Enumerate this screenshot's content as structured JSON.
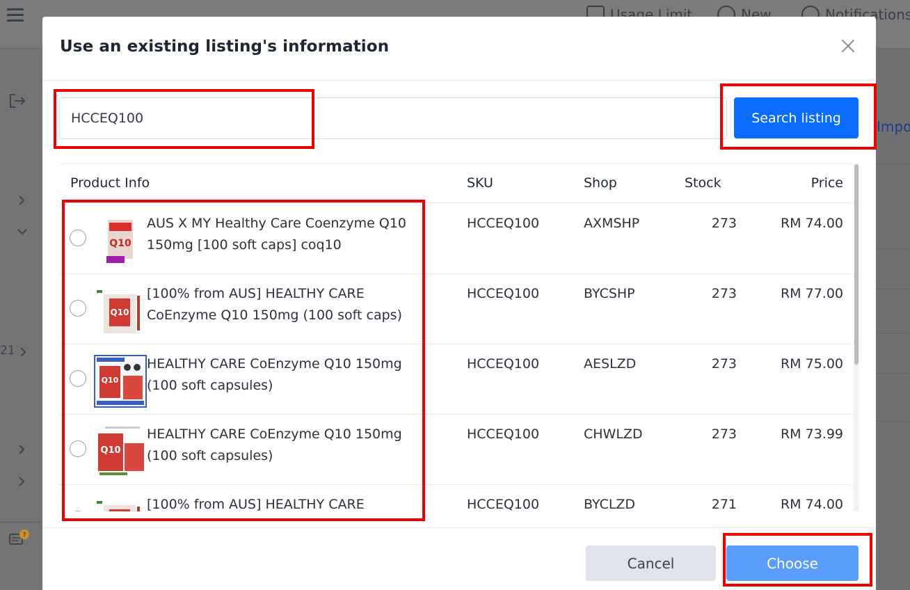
{
  "background": {
    "top_items": [
      {
        "label": "Usage Limit",
        "icon": "box-icon"
      },
      {
        "label": "New",
        "icon": "plus-circle-icon"
      },
      {
        "label": "Notifications",
        "icon": "search-icon"
      }
    ],
    "side_number": "21",
    "right_link": "Impor"
  },
  "modal": {
    "title": "Use an existing listing's information",
    "search": {
      "value": "HCCEQ100",
      "button_label": "Search listing"
    },
    "columns": {
      "product": "Product Info",
      "sku": "SKU",
      "shop": "Shop",
      "stock": "Stock",
      "price": "Price"
    },
    "rows": [
      {
        "name": "AUS X MY Healthy Care Coenzyme Q10 150mg [100 soft caps] coq10",
        "sku": "HCCEQ100",
        "shop": "AXMSHP",
        "stock": "273",
        "price": "RM 74.00"
      },
      {
        "name": "[100% from AUS] HEALTHY CARE CoEnzyme Q10 150mg (100 soft caps)",
        "sku": "HCCEQ100",
        "shop": "BYCSHP",
        "stock": "273",
        "price": "RM 77.00"
      },
      {
        "name": "HEALTHY CARE CoEnzyme Q10 150mg (100 soft capsules)",
        "sku": "HCCEQ100",
        "shop": "AESLZD",
        "stock": "273",
        "price": "RM 75.00"
      },
      {
        "name": "HEALTHY CARE CoEnzyme Q10 150mg (100 soft capsules)",
        "sku": "HCCEQ100",
        "shop": "CHWLZD",
        "stock": "273",
        "price": "RM 73.99"
      },
      {
        "name": "[100% from AUS] HEALTHY CARE",
        "sku": "HCCEQ100",
        "shop": "BYCLZD",
        "stock": "271",
        "price": "RM 74.00"
      }
    ],
    "footer": {
      "cancel_label": "Cancel",
      "choose_label": "Choose"
    }
  },
  "colors": {
    "primary": "#0a6cff",
    "primary_disabled": "#5a9cfb",
    "highlight": "#ee0000",
    "overlay": "#6f7072"
  }
}
